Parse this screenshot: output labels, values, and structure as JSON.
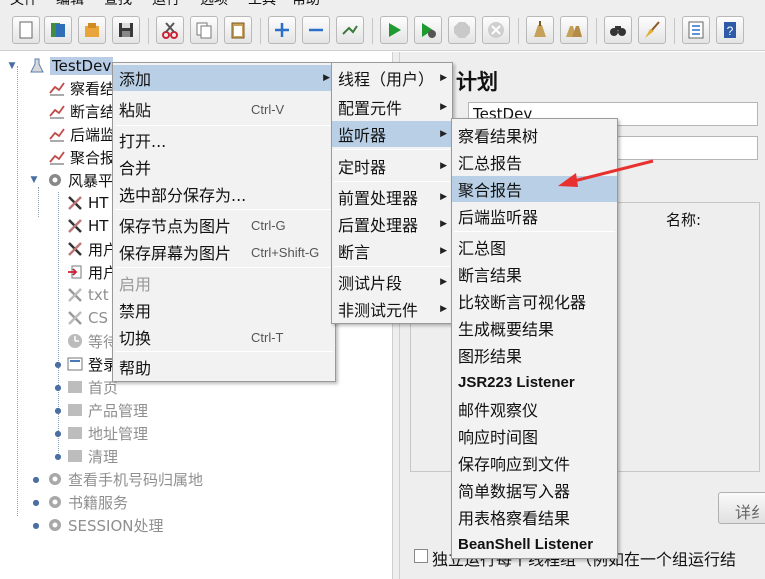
{
  "menubar": [
    "文件",
    "编辑",
    "查找",
    "运行",
    "选项",
    "工具",
    "帮助"
  ],
  "toolbar": {
    "buttons": [
      "new-icon",
      "templates-icon",
      "open-icon",
      "save-icon",
      "cut-icon",
      "copy-icon",
      "paste-icon",
      "expand-icon",
      "collapse-icon",
      "toggle-icon",
      "start-icon",
      "start-no-pause-icon",
      "stop-icon",
      "shutdown-icon",
      "clear-icon",
      "clear-all-icon",
      "search-icon",
      "reset-search-icon",
      "function-helper-icon",
      "help-icon"
    ]
  },
  "tree": {
    "items": [
      {
        "label": "TestDev",
        "icon": "flask-icon",
        "state": "selected"
      },
      {
        "label": "察看结",
        "icon": "graph-icon",
        "state": "normal"
      },
      {
        "label": "断言结",
        "icon": "graph-icon",
        "state": "normal"
      },
      {
        "label": "后端监",
        "icon": "graph-icon",
        "state": "normal"
      },
      {
        "label": "聚合报",
        "icon": "graph-icon",
        "state": "normal"
      },
      {
        "label": "风暴平",
        "icon": "gear-icon",
        "state": "normal"
      },
      {
        "label": "HT",
        "icon": "wrench-icon",
        "state": "normal"
      },
      {
        "label": "HT",
        "icon": "wrench-icon",
        "state": "normal"
      },
      {
        "label": "用户",
        "icon": "wrench-icon",
        "state": "normal"
      },
      {
        "label": "用户",
        "icon": "import-icon",
        "state": "normal"
      },
      {
        "label": "txt",
        "icon": "wrench-icon",
        "state": "disabled"
      },
      {
        "label": "CS",
        "icon": "wrench-icon",
        "state": "disabled"
      },
      {
        "label": "等待",
        "icon": "timer-icon",
        "state": "disabled"
      },
      {
        "label": "登录",
        "icon": "controller-icon",
        "state": "normal"
      },
      {
        "label": "首页",
        "icon": "controller-icon",
        "state": "disabled"
      },
      {
        "label": "产品管理",
        "icon": "controller-icon",
        "state": "disabled"
      },
      {
        "label": "地址管理",
        "icon": "controller-icon",
        "state": "disabled"
      },
      {
        "label": "清理",
        "icon": "controller-icon",
        "state": "disabled"
      },
      {
        "label": "查看手机号码归属地",
        "icon": "gear-icon",
        "state": "disabled"
      },
      {
        "label": "书籍服务",
        "icon": "gear-icon",
        "state": "disabled"
      },
      {
        "label": "SESSION处理",
        "icon": "gear-icon",
        "state": "disabled"
      }
    ]
  },
  "right_panel": {
    "title_fragment": "计划",
    "name_value": "TestDev",
    "name_label": "名称:",
    "detail_button_fragment": "详纟",
    "checkbox_fragment": "独立运行每个线程组（例如在一个组运行结"
  },
  "menu1": {
    "items": [
      {
        "label": "添加",
        "shortcut": "",
        "submenu": true,
        "state": "highlighted"
      },
      {
        "label": "粘贴",
        "shortcut": "Ctrl-V",
        "submenu": false,
        "state": "normal"
      },
      {
        "label": "打开...",
        "shortcut": "",
        "submenu": false,
        "state": "normal"
      },
      {
        "label": "合并",
        "shortcut": "",
        "submenu": false,
        "state": "normal"
      },
      {
        "label": "选中部分保存为...",
        "shortcut": "",
        "submenu": false,
        "state": "normal"
      },
      {
        "label": "保存节点为图片",
        "shortcut": "Ctrl-G",
        "submenu": false,
        "state": "normal"
      },
      {
        "label": "保存屏幕为图片",
        "shortcut": "Ctrl+Shift-G",
        "submenu": false,
        "state": "normal"
      },
      {
        "label": "启用",
        "shortcut": "",
        "submenu": false,
        "state": "disabled"
      },
      {
        "label": "禁用",
        "shortcut": "",
        "submenu": false,
        "state": "normal"
      },
      {
        "label": "切换",
        "shortcut": "Ctrl-T",
        "submenu": false,
        "state": "normal"
      },
      {
        "label": "帮助",
        "shortcut": "",
        "submenu": false,
        "state": "normal"
      }
    ]
  },
  "menu2": {
    "items": [
      {
        "label": "线程（用户）",
        "state": "normal"
      },
      {
        "label": "配置元件",
        "state": "normal"
      },
      {
        "label": "监听器",
        "state": "highlighted"
      },
      {
        "label": "定时器",
        "state": "normal"
      },
      {
        "label": "前置处理器",
        "state": "normal"
      },
      {
        "label": "后置处理器",
        "state": "normal"
      },
      {
        "label": "断言",
        "state": "normal"
      },
      {
        "label": "测试片段",
        "state": "normal"
      },
      {
        "label": "非测试元件",
        "state": "normal"
      }
    ]
  },
  "menu3": {
    "items": [
      {
        "label": "察看结果树",
        "state": "normal"
      },
      {
        "label": "汇总报告",
        "state": "normal"
      },
      {
        "label": "聚合报告",
        "state": "highlighted"
      },
      {
        "label": "后端监听器",
        "state": "normal"
      },
      {
        "label": "汇总图",
        "state": "normal"
      },
      {
        "label": "断言结果",
        "state": "normal"
      },
      {
        "label": "比较断言可视化器",
        "state": "normal"
      },
      {
        "label": "生成概要结果",
        "state": "normal"
      },
      {
        "label": "图形结果",
        "state": "normal"
      },
      {
        "label": "JSR223 Listener",
        "state": "normal"
      },
      {
        "label": "邮件观察仪",
        "state": "normal"
      },
      {
        "label": "响应时间图",
        "state": "normal"
      },
      {
        "label": "保存响应到文件",
        "state": "normal"
      },
      {
        "label": "简单数据写入器",
        "state": "normal"
      },
      {
        "label": "用表格察看结果",
        "state": "normal"
      },
      {
        "label": "BeanShell Listener",
        "state": "normal"
      }
    ]
  },
  "colors": {
    "highlight": "#b8cfe5",
    "arrow": "#e8312f",
    "selected": "#b9cde6"
  }
}
